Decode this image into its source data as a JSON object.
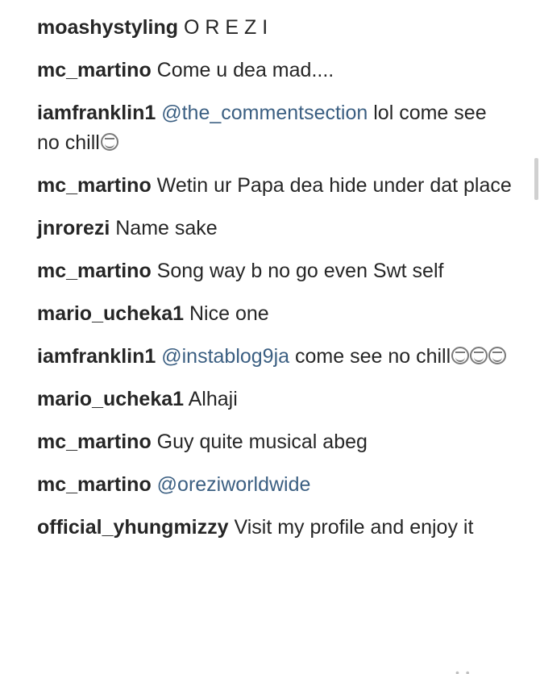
{
  "comments": [
    {
      "user": "moashystyling",
      "text": "O R E Z I"
    },
    {
      "user": "mc_martino",
      "text": "Come u dea mad...."
    },
    {
      "user": "iamfranklin1",
      "mention": "@the_commentsection",
      "text": "lol come see no chill",
      "emoji": "😂"
    },
    {
      "user": "mc_martino",
      "text": "Wetin ur Papa dea hide under dat place"
    },
    {
      "user": "jnrorezi",
      "text": "Name sake"
    },
    {
      "user": "mc_martino",
      "text": "Song way b no go even Swt self"
    },
    {
      "user": "mario_ucheka1",
      "text": "Nice one"
    },
    {
      "user": "iamfranklin1",
      "mention": "@instablog9ja",
      "text": "come see no chill",
      "emoji": "😂😂😂"
    },
    {
      "user": "mario_ucheka1",
      "text": "Alhaji"
    },
    {
      "user": "mc_martino",
      "text": "Guy quite musical abeg"
    },
    {
      "user": "mc_martino",
      "mention": "@oreziworldwide"
    },
    {
      "user": "official_yhungmizzy",
      "text": "Visit my profile and enjoy it"
    }
  ],
  "colors": {
    "username": "#262626",
    "text": "#262626",
    "mention": "#3b5f82",
    "background": "#ffffff"
  }
}
